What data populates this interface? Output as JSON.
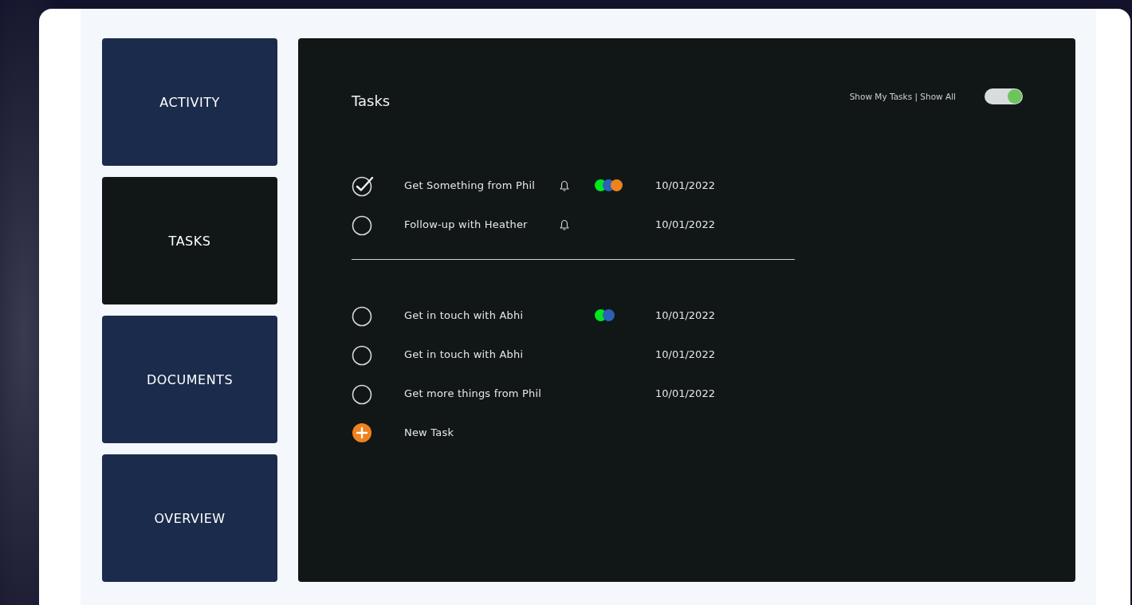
{
  "nav": [
    {
      "label": "ACTIVITY",
      "selected": false
    },
    {
      "label": "TASKS",
      "selected": true
    },
    {
      "label": "DOCUMENTS",
      "selected": false
    },
    {
      "label": "OVERVIEW",
      "selected": false
    }
  ],
  "tasks_panel": {
    "title": "Tasks",
    "filter_label": "Show My Tasks | Show All",
    "show_all_toggle": {
      "on": true
    },
    "groups": [
      {
        "tasks": [
          {
            "checked": true,
            "title": "Get Something from Phil",
            "reminder": true,
            "tags": [
              {
                "color": "#00e620"
              },
              {
                "color": "#2a62b8"
              },
              {
                "color": "#f0821e"
              }
            ],
            "date": "10/01/2022"
          },
          {
            "checked": false,
            "title": "Follow-up with Heather",
            "reminder": true,
            "date": "10/01/2022"
          }
        ]
      },
      {
        "tasks": [
          {
            "checked": false,
            "title": "Get in touch with Abhi",
            "reminder": false,
            "tags": [
              {
                "color": "#00e620"
              },
              {
                "color": "#2a62b8"
              }
            ],
            "date": "10/01/2022"
          },
          {
            "checked": false,
            "title": "Get in touch with Abhi",
            "reminder": false,
            "date": "10/01/2022"
          },
          {
            "checked": false,
            "title": "Get more things from Phil",
            "reminder": false,
            "date": "10/01/2022"
          }
        ]
      }
    ],
    "new_task": {
      "label": "New Task"
    }
  }
}
